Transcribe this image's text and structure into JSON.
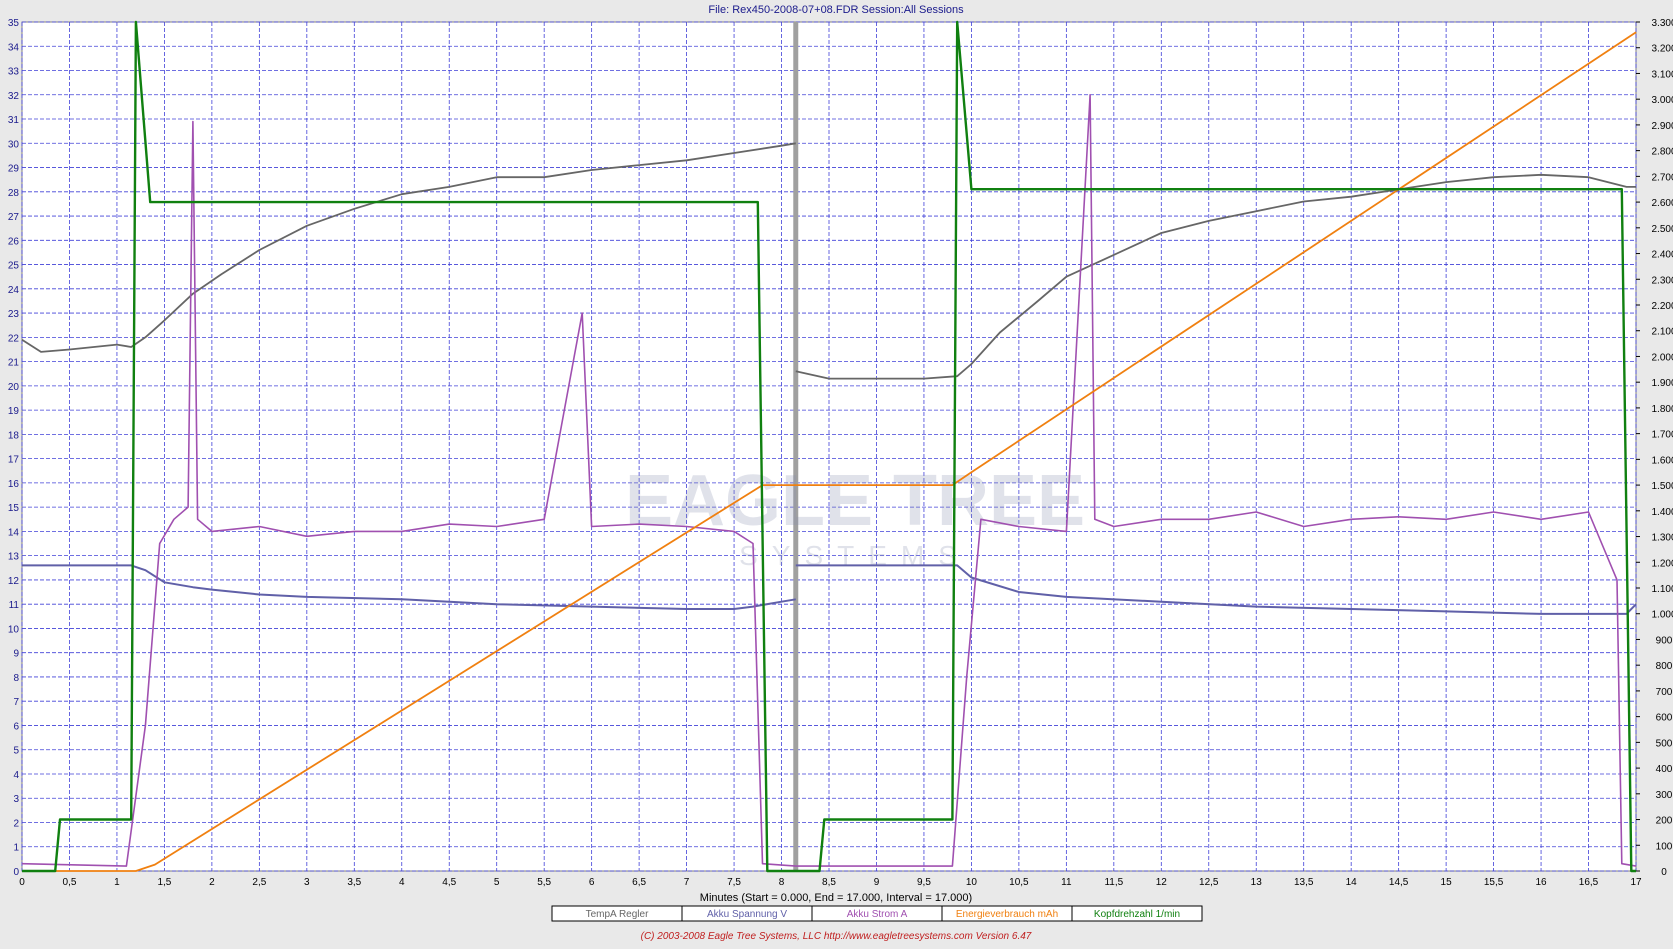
{
  "header": {
    "title": "File: Rex450-2008-07+08.FDR   Session:All Sessions"
  },
  "footer": {
    "axis_caption": "Minutes (Start = 0.000,  End = 17.000,  Interval = 17.000)",
    "copyright": "(C) 2003-2008 Eagle Tree Systems, LLC      http://www.eagletreesystems.com    Version 6.47"
  },
  "watermark": {
    "text": "EAGLE TREE",
    "sub": "SYSTEMS"
  },
  "legend": [
    {
      "label": "TempA Regler",
      "color": "#666666"
    },
    {
      "label": "Akku Spannung V",
      "color": "#6060a8"
    },
    {
      "label": "Akku  Strom   A",
      "color": "#a050b0"
    },
    {
      "label": "Energieverbrauch  mAh",
      "color": "#f08010"
    },
    {
      "label": "Kopfdrehzahl  1/min",
      "color": "#108010"
    }
  ],
  "chart_data": {
    "type": "line",
    "xlim": [
      0,
      17
    ],
    "ylim_left": [
      0,
      35
    ],
    "ylim_right": [
      0,
      3300
    ],
    "grid": true,
    "legend_position": "bottom",
    "x_ticks": [
      "0",
      "0,5",
      "1",
      "1,5",
      "2",
      "2,5",
      "3",
      "3,5",
      "4",
      "4,5",
      "5",
      "5,5",
      "6",
      "6,5",
      "7",
      "7,5",
      "8",
      "8,5",
      "9",
      "9,5",
      "10",
      "10,5",
      "11",
      "11,5",
      "12",
      "12,5",
      "13",
      "13,5",
      "14",
      "14,5",
      "15",
      "15,5",
      "16",
      "16,5",
      "17"
    ],
    "y_left_ticks": [
      "0",
      "1",
      "2",
      "3",
      "4",
      "5",
      "6",
      "7",
      "8",
      "9",
      "10",
      "11",
      "12",
      "13",
      "14",
      "15",
      "16",
      "17",
      "18",
      "19",
      "20",
      "21",
      "22",
      "23",
      "24",
      "25",
      "26",
      "27",
      "28",
      "29",
      "30",
      "31",
      "32",
      "33",
      "34",
      "35"
    ],
    "y_right_ticks": [
      "0",
      "100",
      "200",
      "300",
      "400",
      "500",
      "600",
      "700",
      "800",
      "900",
      "1.000",
      "1.100",
      "1.200",
      "1.300",
      "1.400",
      "1.500",
      "1.600",
      "1.700",
      "1.800",
      "1.900",
      "2.000",
      "2.100",
      "2.200",
      "2.300",
      "2.400",
      "2.500",
      "2.600",
      "2.700",
      "2.800",
      "2.900",
      "3.000",
      "3.100",
      "3.200",
      "3.300"
    ],
    "session_divider_x": 8.15,
    "series": [
      {
        "name": "TempA Regler",
        "axis": "left",
        "x": [
          0,
          0.2,
          0.5,
          1,
          1.15,
          1.3,
          1.5,
          1.8,
          2.1,
          2.5,
          3,
          3.5,
          4,
          4.5,
          5,
          5.5,
          6,
          6.5,
          7,
          7.5,
          8,
          8.15,
          8.15,
          8.5,
          9,
          9.5,
          9.85,
          10,
          10.3,
          10.7,
          11,
          11.5,
          12,
          12.5,
          13,
          13.5,
          14,
          14.5,
          15,
          15.5,
          16,
          16.5,
          16.9,
          17
        ],
        "y": [
          21.9,
          21.4,
          21.5,
          21.7,
          21.6,
          22.0,
          22.7,
          23.8,
          24.6,
          25.6,
          26.6,
          27.3,
          27.9,
          28.2,
          28.6,
          28.6,
          28.9,
          29.1,
          29.3,
          29.6,
          29.9,
          30.0,
          20.6,
          20.3,
          20.3,
          20.3,
          20.4,
          20.9,
          22.2,
          23.5,
          24.5,
          25.4,
          26.3,
          26.8,
          27.2,
          27.6,
          27.8,
          28.1,
          28.4,
          28.6,
          28.7,
          28.6,
          28.2,
          28.2
        ]
      },
      {
        "name": "Akku Spannung V",
        "axis": "left",
        "x": [
          0,
          0.5,
          1,
          1.15,
          1.3,
          1.5,
          1.8,
          2,
          2.5,
          3,
          4,
          5,
          6,
          7,
          7.5,
          7.7,
          8,
          8.15,
          8.15,
          8.5,
          9,
          9.5,
          9.85,
          10,
          10.5,
          11,
          12,
          13,
          14,
          15,
          16,
          16.9,
          17
        ],
        "y": [
          12.6,
          12.6,
          12.6,
          12.6,
          12.4,
          11.9,
          11.7,
          11.6,
          11.4,
          11.3,
          11.2,
          11.0,
          10.9,
          10.8,
          10.8,
          10.9,
          11.1,
          11.2,
          12.6,
          12.6,
          12.6,
          12.6,
          12.6,
          12.1,
          11.5,
          11.3,
          11.1,
          10.9,
          10.8,
          10.7,
          10.6,
          10.6,
          11.0
        ]
      },
      {
        "name": "Akku  Strom   A",
        "axis": "left",
        "x": [
          0,
          1.1,
          1.3,
          1.45,
          1.6,
          1.75,
          1.8,
          1.85,
          2,
          2.5,
          3,
          3.5,
          4,
          4.5,
          5,
          5.5,
          5.9,
          6,
          6.5,
          7,
          7.5,
          7.7,
          7.8,
          8.15,
          8.15,
          9.8,
          9.95,
          10.1,
          10.5,
          11,
          11.25,
          11.3,
          11.5,
          12,
          12.5,
          13,
          13.5,
          14,
          14.5,
          15,
          15.5,
          16,
          16.5,
          16.8,
          16.85,
          17
        ],
        "y": [
          0.3,
          0.2,
          6,
          13.5,
          14.5,
          15,
          30.9,
          14.5,
          14,
          14.2,
          13.8,
          14,
          14,
          14.3,
          14.2,
          14.5,
          23,
          14.2,
          14.3,
          14.2,
          14,
          13.5,
          0.3,
          0.2,
          0.2,
          0.2,
          8,
          14.5,
          14.2,
          14,
          32,
          14.5,
          14.2,
          14.5,
          14.5,
          14.8,
          14.2,
          14.5,
          14.6,
          14.5,
          14.8,
          14.5,
          14.8,
          12,
          0.3,
          0.2
        ]
      },
      {
        "name": "Energieverbrauch  mAh",
        "axis": "right",
        "x": [
          0,
          1.2,
          1.4,
          7.8,
          8.15,
          8.15,
          9.8,
          10,
          17
        ],
        "y": [
          0,
          0,
          25,
          1500,
          1500,
          1500,
          1500,
          1550,
          3260
        ]
      },
      {
        "name": "Kopfdrehzahl  1/min",
        "axis": "right",
        "x": [
          0,
          0.35,
          0.4,
          1.15,
          1.2,
          1.35,
          1.45,
          7.75,
          7.85,
          8.15,
          8.15,
          8.4,
          8.45,
          9.8,
          9.85,
          10.0,
          10.1,
          16.85,
          16.95,
          17
        ],
        "y": [
          0,
          0,
          200,
          200,
          3300,
          2600,
          2600,
          2600,
          0,
          0,
          0,
          0,
          200,
          200,
          3300,
          2650,
          2650,
          2650,
          0,
          0
        ]
      }
    ]
  }
}
